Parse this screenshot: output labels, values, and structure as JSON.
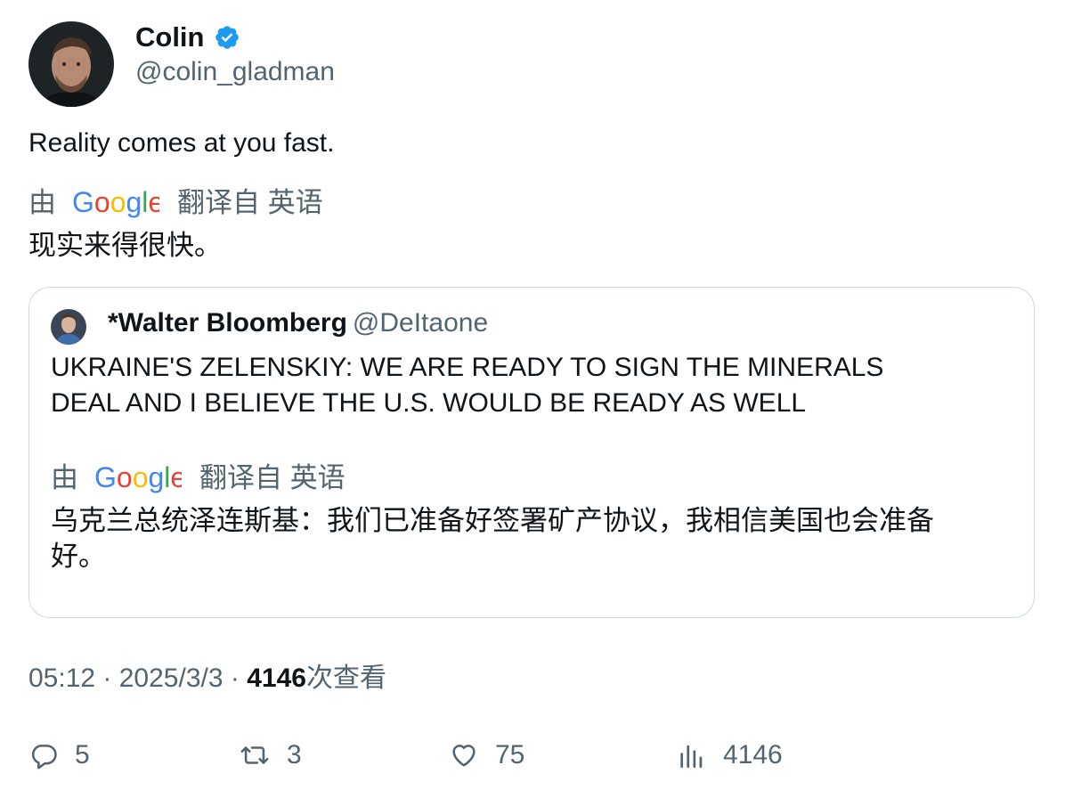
{
  "author": {
    "name": "Colin",
    "handle": "@colin_gladman",
    "verified": true,
    "avatar_icon": "profile-photo"
  },
  "tweet": {
    "text": "Reality comes at you fast.",
    "translation": {
      "by_label": "由",
      "provider": "Google",
      "from_label": "翻译自 英语",
      "text": "现实来得很快。"
    }
  },
  "quote": {
    "name": "*Walter Bloomberg",
    "handle": "@DeItaone",
    "text_line1": "UKRAINE'S ZELENSKIY: WE ARE READY TO SIGN THE MINERALS",
    "text_line2": "DEAL AND I BELIEVE THE U.S. WOULD BE READY AS WELL",
    "translation": {
      "by_label": "由",
      "provider": "Google",
      "from_label": "翻译自 英语",
      "text_line1": "乌克兰总统泽连斯基：我们已准备好签署矿产协议，我相信美国也会准备",
      "text_line2": "好。"
    }
  },
  "meta": {
    "time": "05:12",
    "sep1": " · ",
    "date": "2025/3/3",
    "sep2": " · ",
    "views": "4146",
    "views_label": "次查看"
  },
  "actions": {
    "replies": "5",
    "retweets": "3",
    "likes": "75",
    "views": "4146"
  },
  "colors": {
    "text": "#0f1419",
    "secondary": "#536471",
    "verified": "#1d9bf0",
    "border": "#cfd9de"
  }
}
